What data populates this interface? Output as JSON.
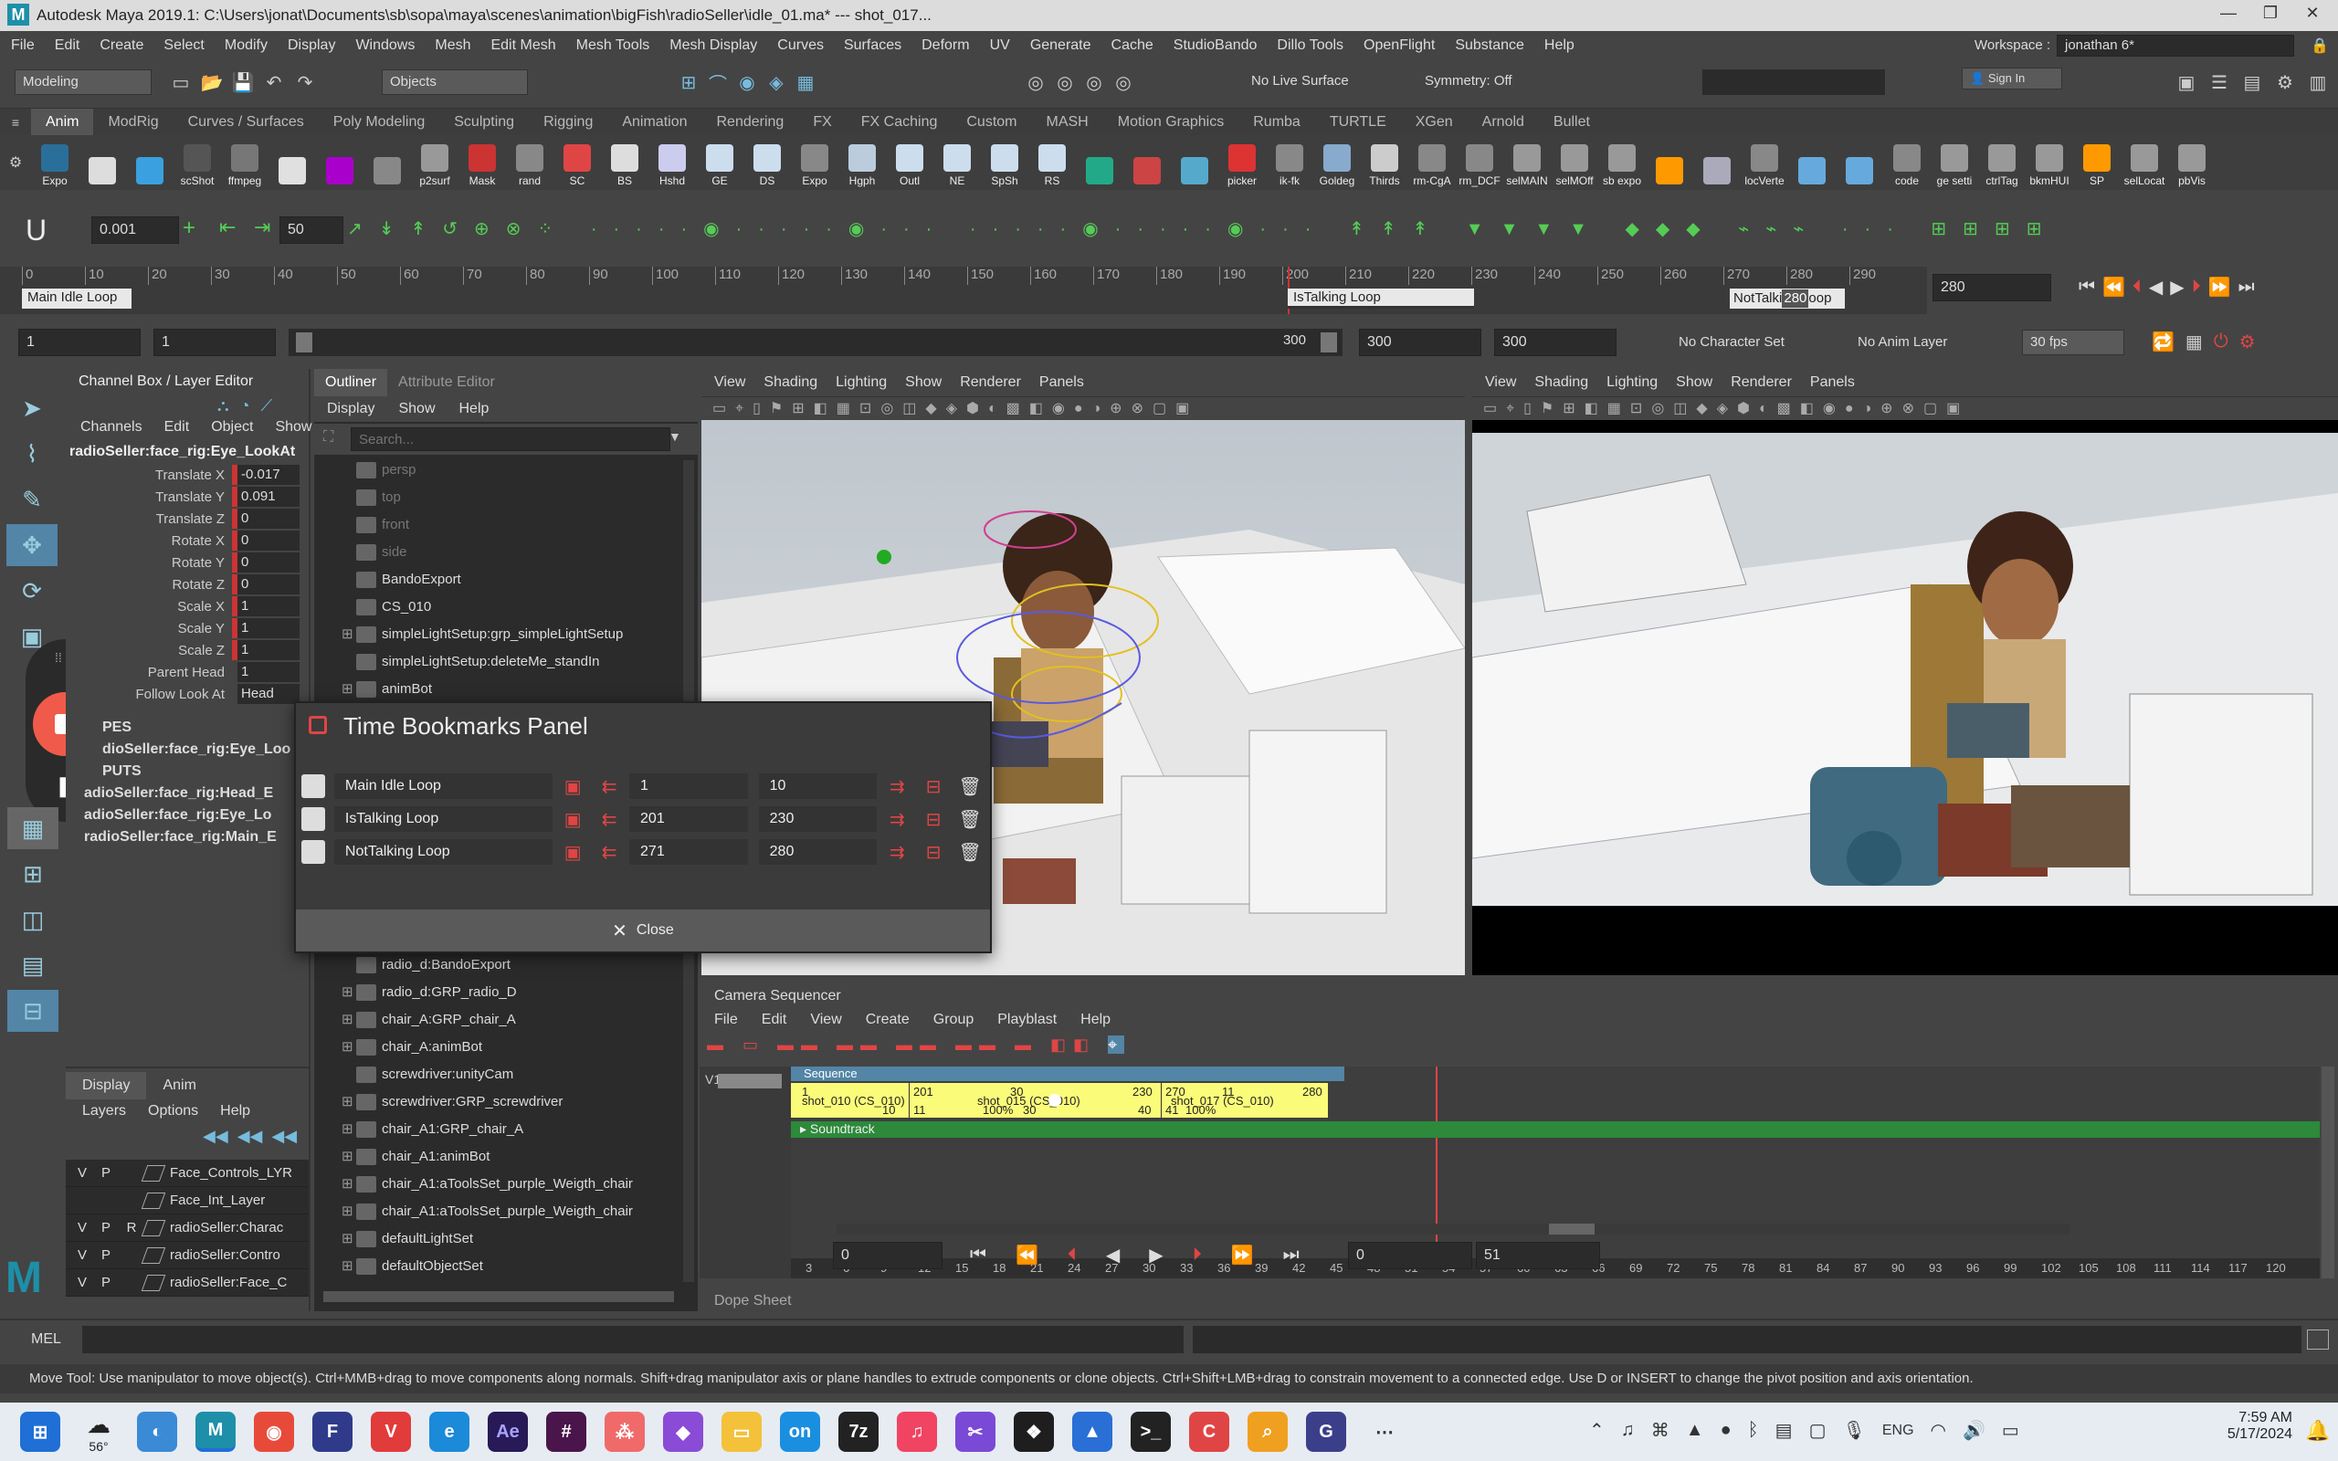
{
  "window": {
    "title": "Autodesk Maya 2019.1: C:\\Users\\jonat\\Documents\\sb\\sopa\\maya\\scenes\\animation\\bigFish\\radioSeller\\idle_01.ma*   ---   shot_017..."
  },
  "menubar": {
    "items": [
      "File",
      "Edit",
      "Create",
      "Select",
      "Modify",
      "Display",
      "Windows",
      "Mesh",
      "Edit Mesh",
      "Mesh Tools",
      "Mesh Display",
      "Curves",
      "Surfaces",
      "Deform",
      "UV",
      "Generate",
      "Cache",
      "StudioBando",
      "Dillo Tools",
      "OpenFlight",
      "Substance",
      "Help"
    ],
    "workspace_label": "Workspace :",
    "workspace_value": "jonathan 6*"
  },
  "statusline": {
    "mode": "Modeling",
    "objects": "Objects",
    "live_surface": "No Live Surface",
    "symmetry": "Symmetry: Off",
    "signin": "Sign In"
  },
  "shelf": {
    "tabs": [
      "Anim",
      "ModRig",
      "Curves / Surfaces",
      "Poly Modeling",
      "Sculpting",
      "Rigging",
      "Animation",
      "Rendering",
      "FX",
      "FX Caching",
      "Custom",
      "MASH",
      "Motion Graphics",
      "Rumba",
      "TURTLE",
      "XGen",
      "Arnold",
      "Bullet"
    ],
    "buttons": [
      "Expo",
      "",
      "",
      "scShot",
      "ffmpeg",
      "",
      "",
      "",
      "p2surf",
      "Mask",
      "rand",
      "SC",
      "BS",
      "Hshd",
      "GE",
      "DS",
      "Expo",
      "Hgph",
      "Outl",
      "NE",
      "SpSh",
      "RS",
      "",
      "",
      "",
      "picker",
      "ik-fk",
      "Goldeg",
      "Thirds",
      "rm-CgA",
      "rm_DCF",
      "selMAIN",
      "selMOff",
      "sb expo",
      "",
      "",
      "locVerte",
      "",
      "",
      "code",
      "ge setti",
      "ctrlTag",
      "bkmHUI",
      "SP",
      "selLocat",
      "pbVis"
    ]
  },
  "toolrow": {
    "value1": "0.001",
    "value2": "50"
  },
  "timeslider": {
    "ticks": [
      "0",
      "10",
      "20",
      "30",
      "40",
      "50",
      "60",
      "70",
      "80",
      "90",
      "100",
      "110",
      "120",
      "130",
      "140",
      "150",
      "160",
      "170",
      "180",
      "190",
      "200",
      "210",
      "220",
      "230",
      "240",
      "250",
      "260",
      "270",
      "280",
      "290"
    ],
    "bookmark1": "Main Idle Loop",
    "bookmark2": "IsTalking Loop",
    "bookmark3": "NotTalki",
    "bookmark3_frame": "280",
    "bookmark3_tail": "oop",
    "current_frame": "280"
  },
  "rangebar": {
    "start": "1",
    "start2": "1",
    "slider_end": "300",
    "end": "300",
    "end2": "300",
    "character_set": "No Character Set",
    "anim_layer": "No Anim Layer",
    "fps": "30 fps"
  },
  "channelbox": {
    "title": "Channel Box / Layer Editor",
    "menus": [
      "Channels",
      "Edit",
      "Object",
      "Show"
    ],
    "object": "radioSeller:face_rig:Eye_LookAt",
    "attrs": [
      {
        "name": "Translate X",
        "value": "-0.017"
      },
      {
        "name": "Translate Y",
        "value": "0.091"
      },
      {
        "name": "Translate Z",
        "value": "0"
      },
      {
        "name": "Rotate X",
        "value": "0"
      },
      {
        "name": "Rotate Y",
        "value": "0"
      },
      {
        "name": "Rotate Z",
        "value": "0"
      },
      {
        "name": "Scale X",
        "value": "1"
      },
      {
        "name": "Scale Y",
        "value": "1"
      },
      {
        "name": "Scale Z",
        "value": "1"
      },
      {
        "name": "Parent Head",
        "value": "1"
      },
      {
        "name": "Follow Look At",
        "value": "Head"
      }
    ],
    "shapes_label": "PES",
    "shapes_item": "dioSeller:face_rig:Eye_Loo",
    "inputs_label": "PUTS",
    "inputs": [
      "adioSeller:face_rig:Head_E",
      "adioSeller:face_rig:Eye_Lo",
      "radioSeller:face_rig:Main_E"
    ],
    "layer_tabs": [
      "Display",
      "Anim"
    ],
    "layer_menus": [
      "Layers",
      "Options",
      "Help"
    ],
    "layers": [
      {
        "v": "V",
        "p": "P",
        "r": "",
        "name": "Face_Controls_LYR"
      },
      {
        "v": "",
        "p": "",
        "r": "",
        "name": "Face_Int_Layer"
      },
      {
        "v": "V",
        "p": "P",
        "r": "R",
        "name": "radioSeller:Charac"
      },
      {
        "v": "V",
        "p": "P",
        "r": "",
        "name": "radioSeller:Contro"
      },
      {
        "v": "V",
        "p": "P",
        "r": "",
        "name": "radioSeller:Face_C"
      }
    ]
  },
  "outliner": {
    "tabs": [
      "Outliner",
      "Attribute Editor"
    ],
    "menus": [
      "Display",
      "Show",
      "Help"
    ],
    "search_placeholder": "Search...",
    "items_top": [
      "persp",
      "top",
      "front",
      "side",
      "BandoExport",
      "CS_010",
      "simpleLightSetup:grp_simpleLightSetup",
      "simpleLightSetup:deleteMe_standIn",
      "animBot"
    ],
    "items_bottom": [
      "radio_d:BandoExport",
      "radio_d:GRP_radio_D",
      "chair_A:GRP_chair_A",
      "chair_A:animBot",
      "screwdriver:unityCam",
      "screwdriver:GRP_screwdriver",
      "chair_A1:GRP_chair_A",
      "chair_A1:animBot",
      "chair_A1:aToolsSet_purple_Weigth_chair",
      "chair_A1:aToolsSet_purple_Weigth_chair",
      "defaultLightSet",
      "defaultObjectSet"
    ]
  },
  "viewport_left": {
    "menus": [
      "View",
      "Shading",
      "Lighting",
      "Show",
      "Renderer",
      "Panels"
    ]
  },
  "viewport_right": {
    "menus": [
      "View",
      "Shading",
      "Lighting",
      "Show",
      "Renderer",
      "Panels"
    ]
  },
  "bookmarks_panel": {
    "title": "Time Bookmarks Panel",
    "rows": [
      {
        "name": "Main Idle Loop",
        "start": "1",
        "end": "10"
      },
      {
        "name": "IsTalking Loop",
        "start": "201",
        "end": "230"
      },
      {
        "name": "NotTalking Loop",
        "start": "271",
        "end": "280"
      }
    ],
    "close_label": "Close"
  },
  "sequencer": {
    "title": "Camera Sequencer",
    "menus": [
      "File",
      "Edit",
      "View",
      "Create",
      "Group",
      "Playblast",
      "Help"
    ],
    "track_label": "V1",
    "sequence_label": "Sequence",
    "shot1": {
      "name": "shot_010 (CS_010)",
      "start": "1",
      "end": "10"
    },
    "shot2": {
      "name": "shot_015 (CS_010)",
      "start": "201",
      "start2": "11",
      "mid": "30",
      "scale": "100%",
      "mid2": "30",
      "end": "230",
      "end2": "40"
    },
    "shot3": {
      "name": "shot_017 (CS_010)",
      "start": "270",
      "start2": "41",
      "mid": "11",
      "scale": "100%",
      "end": "280"
    },
    "soundtrack": "Soundtrack",
    "ruler": [
      "3",
      "6",
      "9",
      "12",
      "15",
      "18",
      "21",
      "24",
      "27",
      "30",
      "33",
      "36",
      "39",
      "42",
      "45",
      "48",
      "51",
      "54",
      "57",
      "60",
      "63",
      "66",
      "69",
      "72",
      "75",
      "78",
      "81",
      "84",
      "87",
      "90",
      "93",
      "96",
      "99",
      "102",
      "105",
      "108",
      "111",
      "114",
      "117",
      "120"
    ],
    "range_start": "0",
    "range_a": "0",
    "range_b": "51",
    "tab_label": "Dope Sheet"
  },
  "mel": {
    "label": "MEL"
  },
  "helpline": {
    "text": "Move Tool: Use manipulator to move object(s). Ctrl+MMB+drag to move components along normals. Shift+drag manipulator axis or plane handles to extrude components or clone objects. Ctrl+Shift+LMB+drag to constrain movement to a connected edge. Use D or INSERT to change the pivot position and axis orientation."
  },
  "taskbar": {
    "weather": "56°",
    "lang": "ENG",
    "time": "7:59 AM",
    "date": "5/17/2024"
  },
  "colors": {
    "accent": "#5285a6",
    "bookmark": "#e8e8e8",
    "red": "#e04545",
    "shot": "#fbfb7a",
    "soundtrack": "#2c8a3a"
  }
}
